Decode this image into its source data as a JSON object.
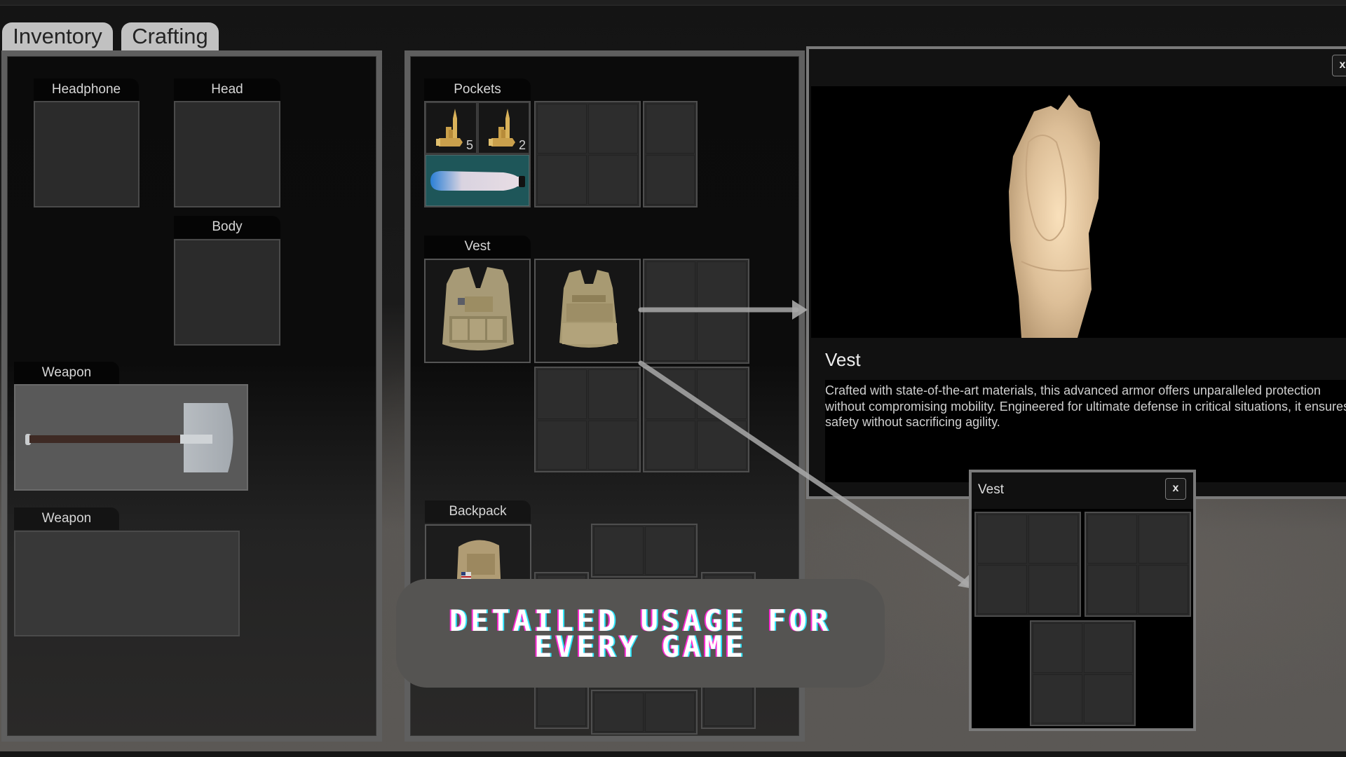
{
  "tabs": [
    {
      "label": "Inventory",
      "active": true
    },
    {
      "label": "Crafting",
      "active": false
    }
  ],
  "equipment": {
    "headphone": {
      "label": "Headphone",
      "item": null
    },
    "head": {
      "label": "Head",
      "item": null
    },
    "body": {
      "label": "Body",
      "item": null
    },
    "weapon_primary": {
      "label": "Weapon",
      "item": "Shovel"
    },
    "weapon_secondary": {
      "label": "Weapon",
      "item": null
    }
  },
  "containers": {
    "pockets": {
      "label": "Pockets",
      "items": [
        {
          "name": "Rifle ammo",
          "icon": "bullets-icon",
          "count": "5"
        },
        {
          "name": "Rifle ammo",
          "icon": "bullets-icon",
          "count": "2"
        },
        {
          "name": "Water bottle",
          "icon": "water-bottle-icon",
          "count": ""
        }
      ],
      "highlight_color": "#1e5659"
    },
    "vest": {
      "label": "Vest",
      "equipped_item": "Tactical vest",
      "stored_items": [
        "Tactical vest"
      ]
    },
    "backpack": {
      "label": "Backpack",
      "equipped_item": "Tactical backpack"
    }
  },
  "detail_panel": {
    "title": "Vest",
    "description": "Crafted with state-of-the-art materials, this advanced armor offers unparalleled protection without compromising mobility. Engineered for ultimate defense in critical situations, it ensures safety without sacrificing agility.",
    "close_label": "x"
  },
  "vest_popup": {
    "title": "Vest",
    "close_label": "x"
  },
  "banner": {
    "line1": "Detailed usage for",
    "line2": "every game"
  }
}
